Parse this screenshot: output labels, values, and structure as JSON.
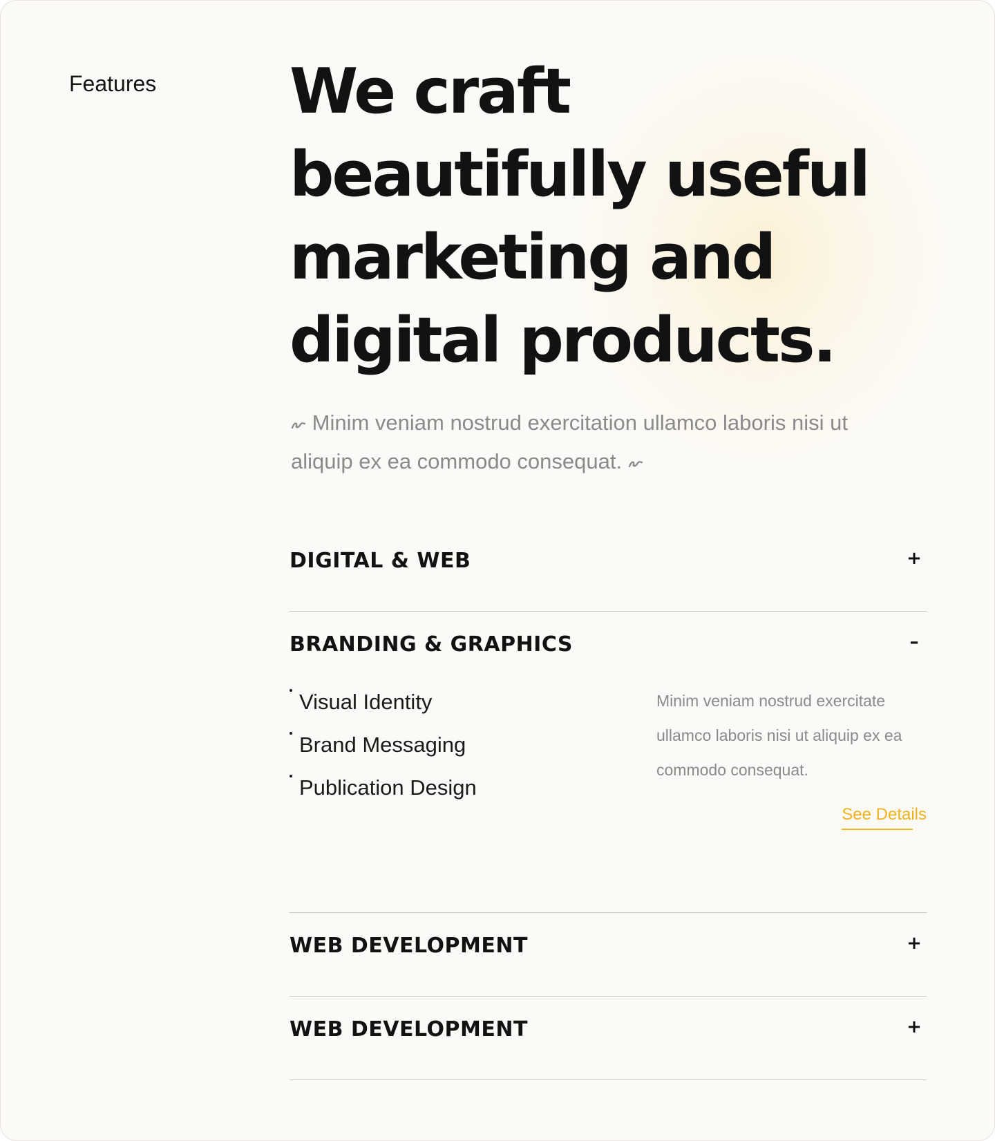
{
  "side_label": "Features",
  "headline": {
    "lines": [
      "We craft",
      "beautifully useful",
      "marketing and",
      "digital products."
    ]
  },
  "intro": {
    "text": "Minim veniam nostrud exercitation ullamco laboris nisi ut aliquip ex ea commodo consequat.",
    "icon": "squiggle-icon"
  },
  "accordion": {
    "items": [
      {
        "title": "DIGITAL & WEB",
        "toggle": "+",
        "expanded": false
      },
      {
        "title": "BRANDING & GRAPHICS",
        "toggle": "–",
        "expanded": true,
        "list": [
          "Visual Identity",
          "Brand Messaging",
          "Publication Design"
        ],
        "description": "Minim veniam nostrud exercitate ullamco laboris nisi ut aliquip ex ea commodo consequat.",
        "link_label": "See Details"
      },
      {
        "title": "WEB DEVELOPMENT",
        "toggle": "+",
        "expanded": false
      },
      {
        "title": "WEB DEVELOPMENT",
        "toggle": "+",
        "expanded": false
      }
    ]
  },
  "colors": {
    "background": "#fcfaf6",
    "text": "#121212",
    "muted": "#8a8a8a",
    "accent": "#f0b21e",
    "divider": "#c9c7c2"
  }
}
